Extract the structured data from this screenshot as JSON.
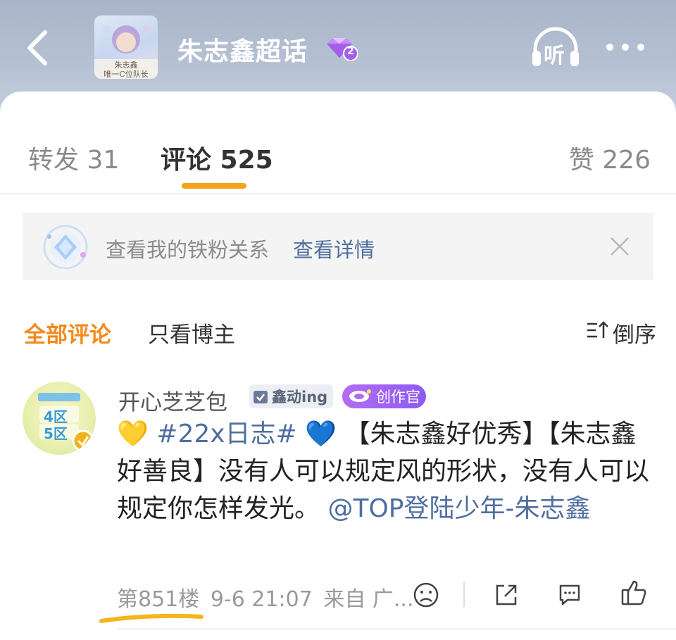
{
  "header": {
    "title": "朱志鑫超话",
    "level_badge": "2",
    "listen_label": "听",
    "avatar_caption_line1": "朱志鑫",
    "avatar_caption_line2": "唯一C位队长"
  },
  "tabs": {
    "forward": "转发 31",
    "comment": "评论 525",
    "like": "赞 226"
  },
  "banner": {
    "text": "查看我的铁粉关系",
    "link": "查看详情"
  },
  "filters": {
    "all": "全部评论",
    "author_only": "只看博主",
    "sort": "倒序"
  },
  "comment": {
    "username": "开心芝芝包",
    "badge1": "鑫动ing",
    "badge2": "创作官",
    "avatar_text1": "4区",
    "avatar_text2": "5区",
    "emoji_yellow_heart": "💛",
    "hashtag": "#22x日志#",
    "emoji_blue_heart": "💙",
    "text_part1": " 【朱志鑫好优秀】【朱志鑫好善良】没有人可以规定风的形状，没有人可以规定你怎样发光。",
    "mention": "@TOP登陆少年-朱志鑫",
    "floor": "第851楼",
    "time": "9-6 21:07",
    "source": "来自 广...",
    "colors": {
      "accent": "#f3a21a",
      "link": "#4f6ea0"
    }
  }
}
